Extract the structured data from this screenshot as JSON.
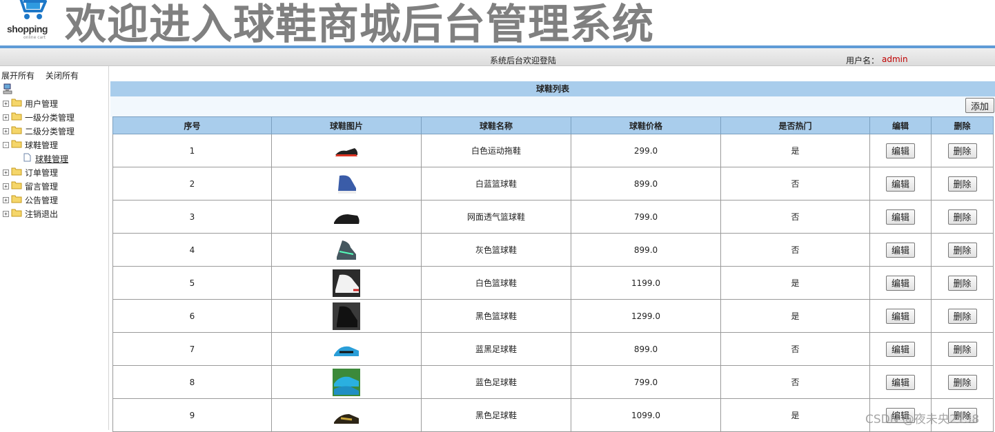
{
  "header": {
    "logo_text": "shopping",
    "logo_sub": "online cart",
    "title": "欢迎进入球鞋商城后台管理系统"
  },
  "statusbar": {
    "welcome": "系统后台欢迎登陆",
    "user_label": "用户名：",
    "user_name": "admin"
  },
  "sidebar": {
    "expand_all": "展开所有",
    "collapse_all": "关闭所有",
    "nodes": [
      {
        "label": "用户管理",
        "toggle": "+"
      },
      {
        "label": "一级分类管理",
        "toggle": "+"
      },
      {
        "label": "二级分类管理",
        "toggle": "+"
      },
      {
        "label": "球鞋管理",
        "toggle": "-"
      },
      {
        "label": "订单管理",
        "toggle": "+"
      },
      {
        "label": "留言管理",
        "toggle": "+"
      },
      {
        "label": "公告管理",
        "toggle": "+"
      },
      {
        "label": "注销退出",
        "toggle": "+"
      }
    ],
    "child": "球鞋管理"
  },
  "panel": {
    "title": "球鞋列表",
    "add_label": "添加"
  },
  "table": {
    "columns": [
      "序号",
      "球鞋图片",
      "球鞋名称",
      "球鞋价格",
      "是否热门",
      "编辑",
      "删除"
    ],
    "edit_label": "编辑",
    "delete_label": "删除",
    "rows": [
      {
        "id": "1",
        "name": "白色运动拖鞋",
        "price": "299.0",
        "hot": "是"
      },
      {
        "id": "2",
        "name": "白蓝篮球鞋",
        "price": "899.0",
        "hot": "否"
      },
      {
        "id": "3",
        "name": "网面透气篮球鞋",
        "price": "799.0",
        "hot": "否"
      },
      {
        "id": "4",
        "name": "灰色篮球鞋",
        "price": "899.0",
        "hot": "否"
      },
      {
        "id": "5",
        "name": "白色篮球鞋",
        "price": "1199.0",
        "hot": "是"
      },
      {
        "id": "6",
        "name": "黑色篮球鞋",
        "price": "1299.0",
        "hot": "是"
      },
      {
        "id": "7",
        "name": "蓝黑足球鞋",
        "price": "899.0",
        "hot": "否"
      },
      {
        "id": "8",
        "name": "蓝色足球鞋",
        "price": "799.0",
        "hot": "否"
      },
      {
        "id": "9",
        "name": "黑色足球鞋",
        "price": "1099.0",
        "hot": "是"
      }
    ]
  },
  "watermark": "CSDN @夜未央2138",
  "colors": {
    "header_line": "#5f9bd6",
    "table_header": "#a9cdec",
    "username": "#c00000",
    "title_gray": "#808080"
  }
}
